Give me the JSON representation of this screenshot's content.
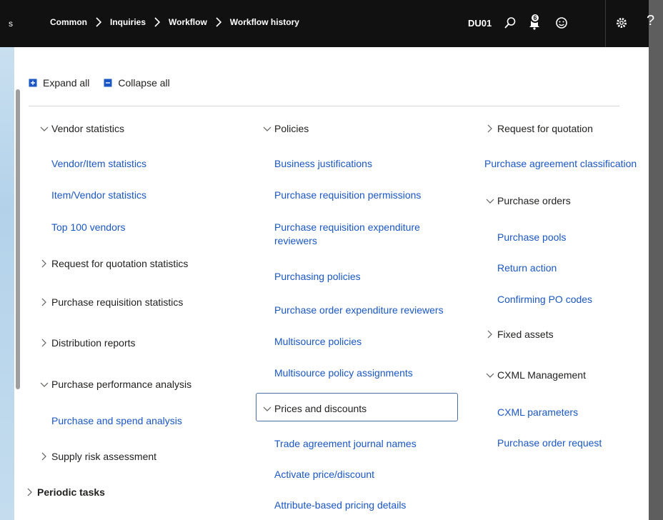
{
  "topbar": {
    "left_stub": "s",
    "breadcrumbs": [
      "Common",
      "Inquiries",
      "Workflow",
      "Workflow history"
    ],
    "company": "DU01",
    "notification_count": "6",
    "help_label": "?"
  },
  "actions": {
    "expand_all": "Expand all",
    "collapse_all": "Collapse all"
  },
  "menu": {
    "col1": {
      "vendor_statistics": "Vendor statistics",
      "vendor_item_statistics": "Vendor/Item statistics",
      "item_vendor_statistics": "Item/Vendor statistics",
      "top_100_vendors": "Top 100 vendors",
      "rfq_statistics": "Request for quotation statistics",
      "purchase_req_statistics": "Purchase requisition statistics",
      "distribution_reports": "Distribution reports",
      "purchase_performance_analysis": "Purchase performance analysis",
      "purchase_and_spend_analysis": "Purchase and spend analysis",
      "supply_risk_assessment": "Supply risk assessment",
      "periodic_tasks": "Periodic tasks"
    },
    "col2": {
      "policies": "Policies",
      "business_justifications": "Business justifications",
      "purchase_req_permissions": "Purchase requisition permissions",
      "purchase_req_expenditure_line1": "Purchase requisition expenditure",
      "purchase_req_expenditure_line2": "reviewers",
      "purchasing_policies": "Purchasing policies",
      "po_expenditure_reviewers": "Purchase order expenditure reviewers",
      "multisource_policies": "Multisource policies",
      "multisource_policy_assignments": "Multisource policy assignments",
      "prices_and_discounts": "Prices and discounts",
      "trade_agreement_journal_names": "Trade agreement journal names",
      "activate_price_discount": "Activate price/discount",
      "attribute_based_pricing_details": "Attribute-based pricing details"
    },
    "col3": {
      "request_for_quotation": "Request for quotation",
      "purchase_agreement_classification": "Purchase agreement classification",
      "purchase_orders": "Purchase orders",
      "purchase_pools": "Purchase pools",
      "return_action": "Return action",
      "confirming_po_codes": "Confirming PO codes",
      "fixed_assets": "Fixed assets",
      "cxml_management": "CXML Management",
      "cxml_parameters": "CXML parameters",
      "purchase_order_request": "Purchase order request"
    }
  },
  "icons": {
    "search": "search-icon",
    "notifications": "bell-icon",
    "feedback": "smiley-icon",
    "settings": "gear-icon",
    "help": "help-icon",
    "expand": "expand-all-icon",
    "collapse": "collapse-all-icon",
    "chevron_down": "chevron-down-icon",
    "chevron_right": "chevron-right-icon"
  },
  "colors": {
    "topbar_bg": "#111111",
    "link": "#1a56c4",
    "text": "#201f1e",
    "focus_border": "#4c6ea8"
  }
}
